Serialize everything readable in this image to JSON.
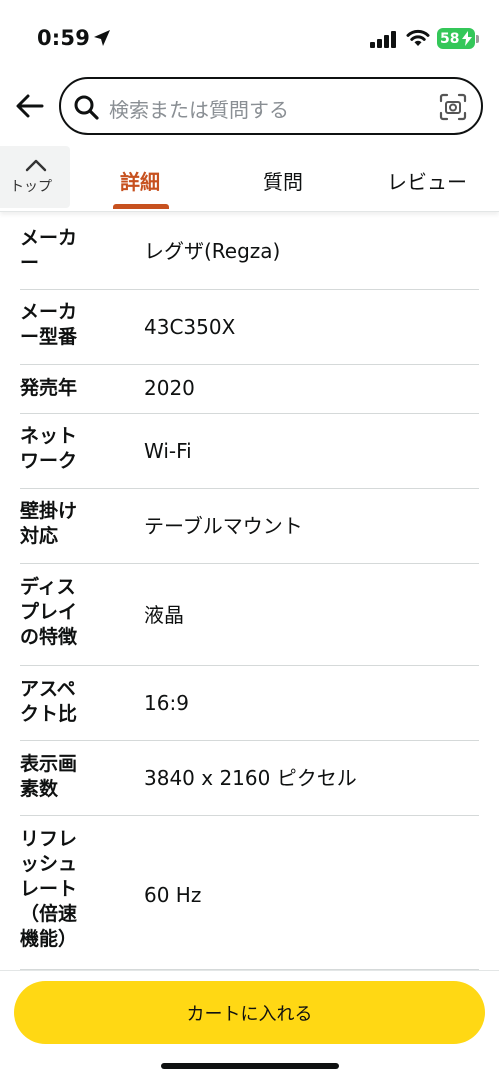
{
  "status_bar": {
    "time": "0:59",
    "battery": "58"
  },
  "search": {
    "placeholder": "検索または質問する"
  },
  "tabs": {
    "top_label": "トップ",
    "items": [
      {
        "label": "詳細",
        "active": true
      },
      {
        "label": "質問",
        "active": false
      },
      {
        "label": "レビュー",
        "active": false
      }
    ]
  },
  "specs": [
    {
      "label": "メーカー",
      "value": "レグザ(Regza)"
    },
    {
      "label": "メーカー型番",
      "value": "43C350X"
    },
    {
      "label": "発売年",
      "value": "2020"
    },
    {
      "label": "ネットワーク",
      "value": "Wi-Fi"
    },
    {
      "label": "壁掛け対応",
      "value": "テーブルマウント"
    },
    {
      "label": "ディスプレイの特徴",
      "value": "液晶"
    },
    {
      "label": "アスペクト比",
      "value": "16:9"
    },
    {
      "label": "表示画素数",
      "value": "3840 x 2160 ピクセル"
    },
    {
      "label": "リフレッシュレート（倍速機能）",
      "value": "60 Hz"
    }
  ],
  "cart": {
    "label": "カートに入れる"
  },
  "colors": {
    "accent": "#c7511f",
    "cart_button": "#ffd814",
    "battery": "#34c759"
  }
}
